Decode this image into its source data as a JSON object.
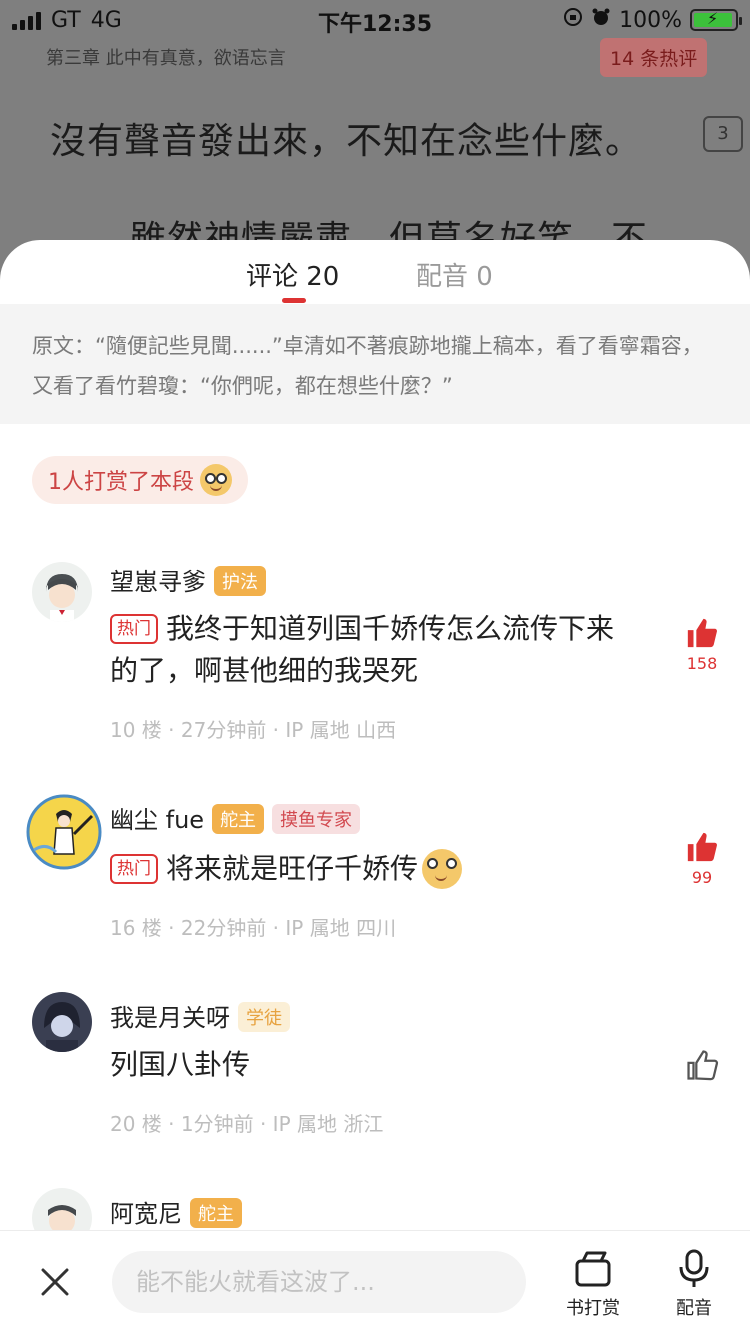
{
  "status": {
    "carrier": "GT",
    "network": "4G",
    "time": "下午12:35",
    "battery": "100%"
  },
  "reader": {
    "chapter": "第三章 此中有真意，欲语忘言",
    "hot_badge": "14 条热评",
    "line1": "沒有聲音發出來，不知在念些什麼。",
    "comment_count": "3",
    "line2": "雖然神情嚴肅，但莫名好笑，不"
  },
  "tabs": [
    {
      "label": "评论 20"
    },
    {
      "label": "配音 0"
    }
  ],
  "quote": "原文：“隨便記些見聞......”卓清如不著痕跡地攏上稿本，看了看寧霜容，又看了看竹碧瓊：“你們呢，都在想些什麼？”",
  "tip": "1人打赏了本段",
  "comments": [
    {
      "nick": "望崽寻爹",
      "badges": [
        "护法"
      ],
      "hot": "热门",
      "text": "我终于知道列国千娇传怎么流传下来的了，啊甚他细的我哭死",
      "meta": "10 楼 · 27分钟前 · IP 属地 山西",
      "likes": "158"
    },
    {
      "nick": "幽尘 fue",
      "badges": [
        "舵主",
        "摸鱼专家"
      ],
      "hot": "热门",
      "text": "将来就是旺仔千娇传",
      "meta": "16 楼 · 22分钟前 · IP 属地 四川",
      "likes": "99"
    },
    {
      "nick": "我是月关呀",
      "badges": [
        "学徒"
      ],
      "text": "列国八卦传",
      "meta": "20 楼 · 1分钟前 · IP 属地 浙江"
    },
    {
      "nick": "阿宽尼",
      "badges": [
        "舵主"
      ]
    }
  ],
  "bottom": {
    "placeholder": "能不能火就看这波了...",
    "tip_label": "书打赏",
    "dub_label": "配音"
  },
  "colors": {
    "accent": "#dd3333",
    "gold": "#f2b04b"
  }
}
